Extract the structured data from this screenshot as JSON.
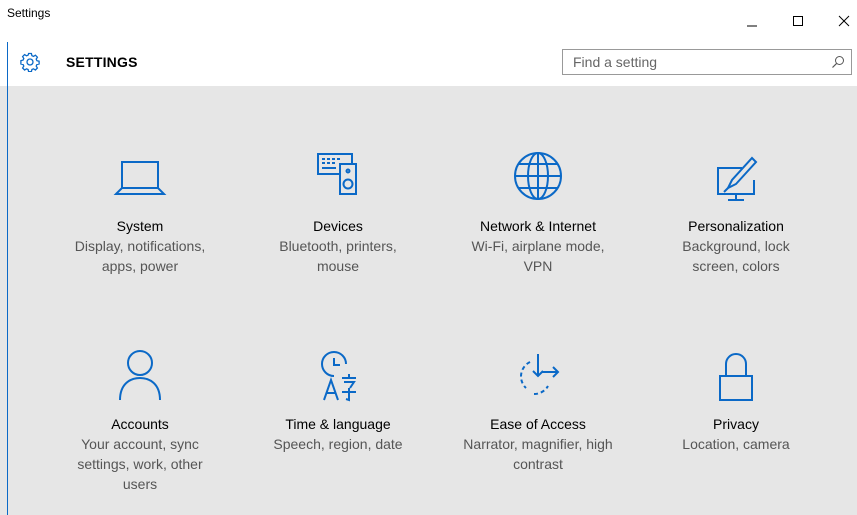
{
  "window": {
    "title": "Settings",
    "minimize_icon": "minimize-icon",
    "maximize_icon": "maximize-icon",
    "close_icon": "close-icon"
  },
  "header": {
    "title": "SETTINGS",
    "icon": "gear-icon"
  },
  "search": {
    "placeholder": "Find a setting",
    "value": "",
    "icon": "search-icon"
  },
  "accent_color": "#0b69c7",
  "tiles": [
    {
      "name": "System",
      "description": "Display, notifications, apps, power",
      "icon": "laptop-icon"
    },
    {
      "name": "Devices",
      "description": "Bluetooth, printers, mouse",
      "icon": "keyboard-speaker-icon"
    },
    {
      "name": "Network & Internet",
      "description": "Wi-Fi, airplane mode, VPN",
      "icon": "globe-icon"
    },
    {
      "name": "Personalization",
      "description": "Background, lock screen, colors",
      "icon": "paintbrush-screen-icon"
    },
    {
      "name": "Accounts",
      "description": "Your account, sync settings, work, other users",
      "icon": "person-icon"
    },
    {
      "name": "Time & language",
      "description": "Speech, region, date",
      "icon": "clock-language-icon"
    },
    {
      "name": "Ease of Access",
      "description": "Narrator, magnifier, high contrast",
      "icon": "ease-of-access-icon"
    },
    {
      "name": "Privacy",
      "description": "Location, camera",
      "icon": "lock-icon"
    }
  ]
}
